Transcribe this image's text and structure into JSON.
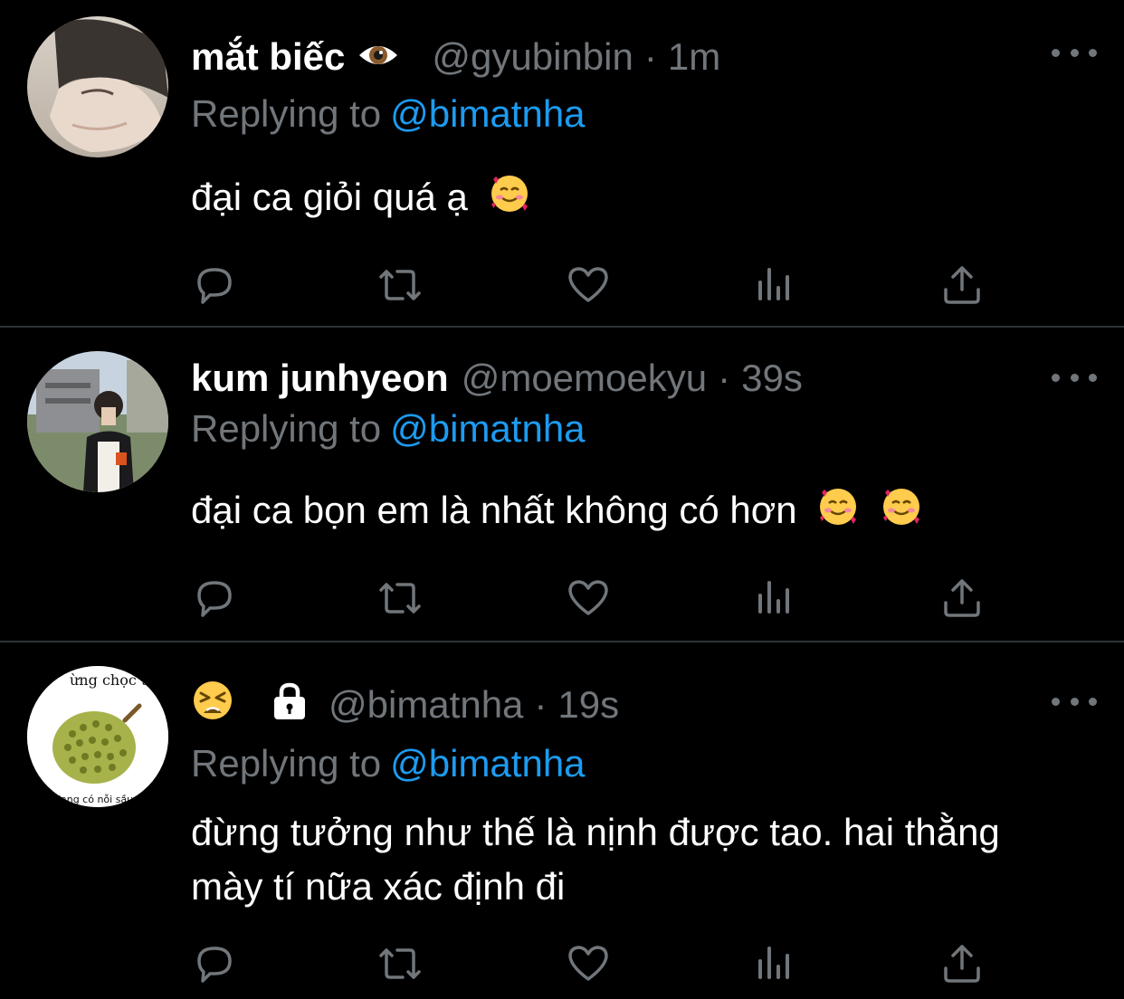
{
  "tweets": [
    {
      "display_name": "mắt biếc",
      "name_emoji_icon": "eye-icon",
      "handle": "@gyubinbin",
      "time": "1m",
      "replying_label": "Replying to",
      "replying_to": "@bimatnha",
      "text": "đại ca giỏi quá ạ"
    },
    {
      "display_name": "kum junhyeon",
      "handle": "@moemoekyu",
      "time": "39s",
      "replying_label": "Replying to",
      "replying_to": "@bimatnha",
      "text": "đại ca bọn em là nhất không có hơn"
    },
    {
      "display_name": "",
      "name_emoji_icon": "tired-face-emoji",
      "protected_icon": "lock-icon",
      "handle": "@bimatnha",
      "time": "19s",
      "replying_label": "Replying to",
      "replying_to": "@bimatnha",
      "text": "đừng tưởng như thế là nịnh được tao. hai thằng mày tí nữa xác định đi",
      "avatar_text_top": "ừng chọc ta",
      "avatar_text_bottom": "đang có nỗi sầu riê"
    }
  ],
  "separator_dot": "·",
  "icons": [
    "reply-icon",
    "retweet-icon",
    "like-icon",
    "analytics-icon",
    "share-icon",
    "more-icon"
  ],
  "colors": {
    "background": "#000000",
    "link": "#1d9bf0",
    "muted": "#71767b",
    "divider": "#2f3336"
  }
}
